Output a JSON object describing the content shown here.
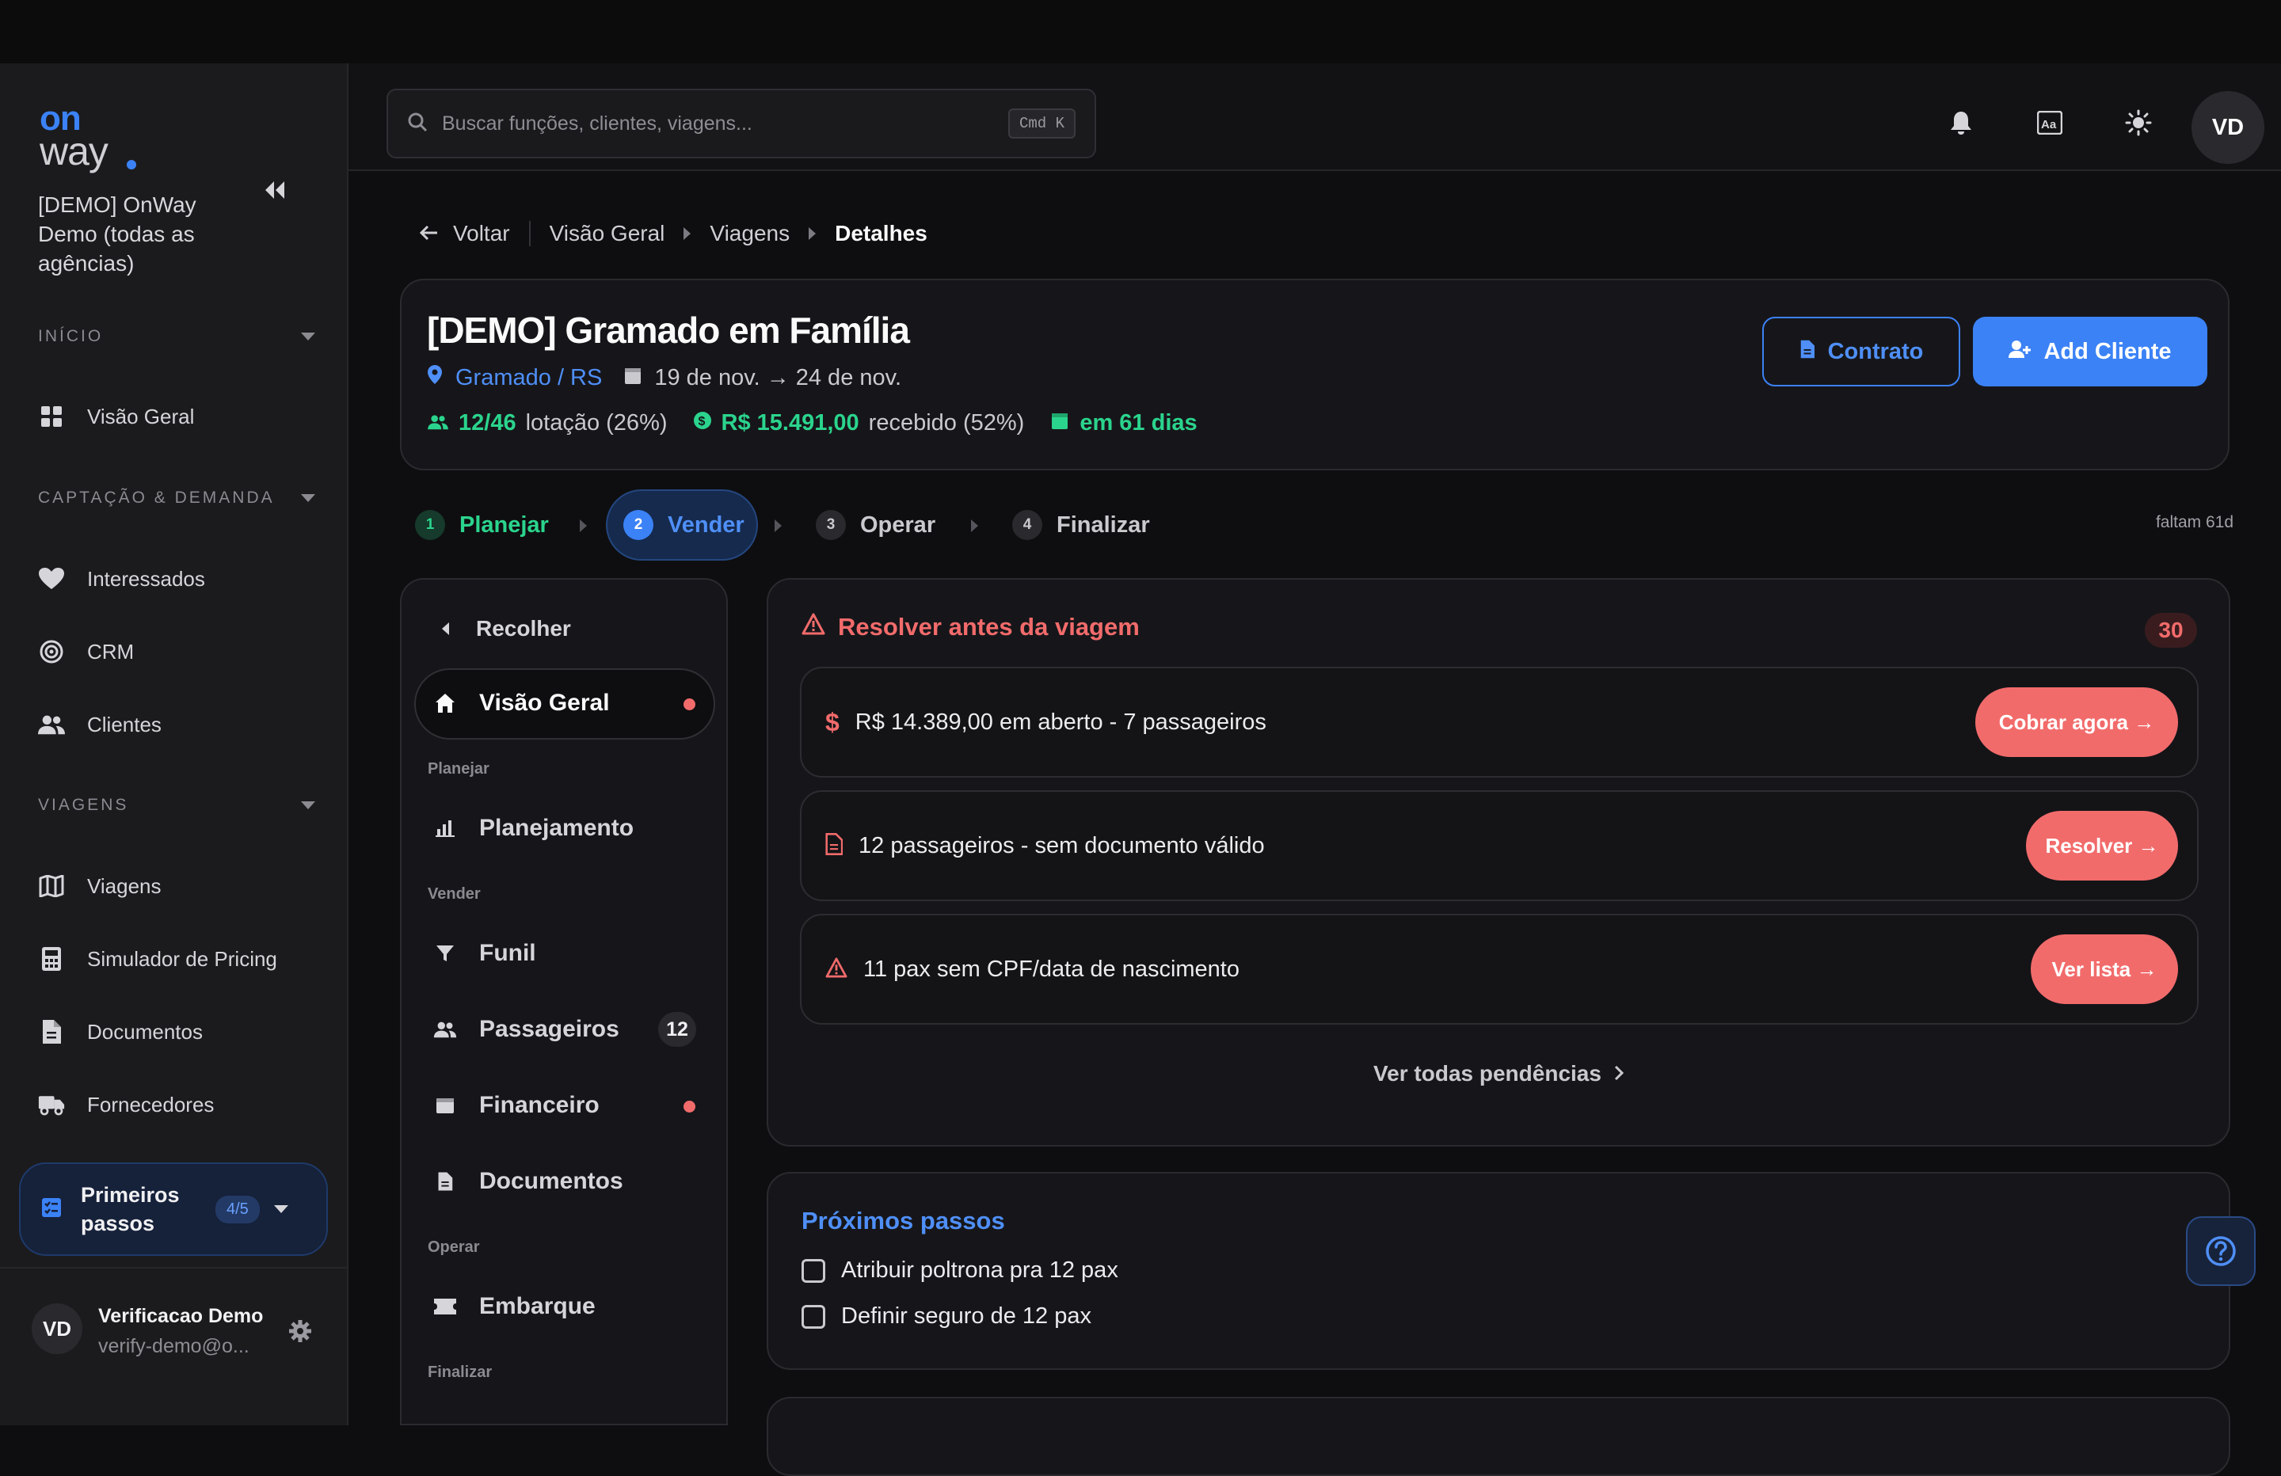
{
  "sidebar": {
    "logo_top": "on",
    "logo_bottom": "way",
    "org": "[DEMO] OnWay Demo (todas as agências)",
    "sections": [
      {
        "label": "INÍCIO",
        "items": [
          {
            "label": "Visão Geral",
            "icon": "grid-icon"
          }
        ]
      },
      {
        "label": "CAPTAÇÃO & DEMANDA",
        "items": [
          {
            "label": "Interessados",
            "icon": "heart-icon"
          },
          {
            "label": "CRM",
            "icon": "target-icon"
          },
          {
            "label": "Clientes",
            "icon": "users-icon"
          }
        ]
      },
      {
        "label": "VIAGENS",
        "items": [
          {
            "label": "Viagens",
            "icon": "map-icon"
          },
          {
            "label": "Simulador de Pricing",
            "icon": "calculator-icon"
          },
          {
            "label": "Documentos",
            "icon": "document-icon"
          },
          {
            "label": "Fornecedores",
            "icon": "truck-icon"
          }
        ]
      }
    ],
    "onboarding": {
      "label": "Primeiros passos",
      "progress": "4/5"
    },
    "user": {
      "initials": "VD",
      "name": "Verificacao Demo",
      "email": "verify-demo@o..."
    }
  },
  "header": {
    "search_placeholder": "Buscar funções, clientes, viagens...",
    "shortcut": "Cmd K",
    "avatar": "VD"
  },
  "breadcrumb": {
    "back": "Voltar",
    "items": [
      "Visão Geral",
      "Viagens",
      "Detalhes"
    ]
  },
  "trip": {
    "title": "[DEMO] Gramado em Família",
    "location": "Gramado / RS",
    "dates": "19 de nov. → 24 de nov.",
    "occupancy_value": "12/46",
    "occupancy_label": "lotação (26%)",
    "received_value": "R$ 15.491,00",
    "received_label": "recebido (52%)",
    "countdown": "em 61 dias",
    "contract_button": "Contrato",
    "add_client_button": "Add Cliente"
  },
  "stepper": {
    "steps": [
      {
        "num": "1",
        "label": "Planejar",
        "state": "done"
      },
      {
        "num": "2",
        "label": "Vender",
        "state": "active"
      },
      {
        "num": "3",
        "label": "Operar",
        "state": "todo"
      },
      {
        "num": "4",
        "label": "Finalizar",
        "state": "todo"
      }
    ],
    "remaining": "faltam 61d"
  },
  "subnav": {
    "collapse": "Recolher",
    "overview": "Visão Geral",
    "groups": [
      {
        "label": "Planejar",
        "items": [
          {
            "label": "Planejamento"
          }
        ]
      },
      {
        "label": "Vender",
        "items": [
          {
            "label": "Funil"
          },
          {
            "label": "Passageiros",
            "count": "12"
          },
          {
            "label": "Financeiro"
          },
          {
            "label": "Documentos"
          }
        ]
      },
      {
        "label": "Operar",
        "items": [
          {
            "label": "Embarque"
          }
        ]
      },
      {
        "label": "Finalizar",
        "items": []
      }
    ]
  },
  "resolve": {
    "title": "Resolver antes da viagem",
    "count": "30",
    "issues": [
      {
        "text": "R$ 14.389,00 em aberto - 7 passageiros",
        "action": "Cobrar agora →"
      },
      {
        "text": "12 passageiros - sem documento válido",
        "action": "Resolver →"
      },
      {
        "text": "11 pax sem CPF/data de nascimento",
        "action": "Ver lista →"
      }
    ],
    "view_all": "Ver todas pendências"
  },
  "next_steps": {
    "title": "Próximos passos",
    "items": [
      "Atribuir poltrona pra 12 pax",
      "Definir seguro de 12 pax"
    ]
  },
  "colors": {
    "accent": "#3b82f6",
    "danger": "#f26b6b",
    "success": "#2bd48d"
  }
}
